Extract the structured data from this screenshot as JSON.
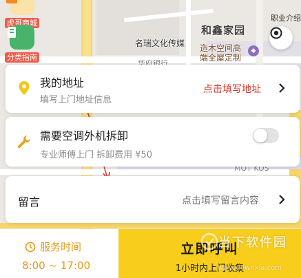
{
  "map": {
    "labels": {
      "tuijian": "虎哥商城",
      "guide": "分类指南",
      "market": "职业介绍",
      "hexin": "和鑫家园",
      "mingrui": "名瑞文化传媒",
      "zaowu_1": "造木空间高",
      "zaowu_2": "端全屋定制",
      "huafu": "华府银行",
      "mot": "MOT KOS"
    }
  },
  "address_card": {
    "title": "我的地址",
    "subtitle": "填写上门地址信息",
    "action": "点击填写地址"
  },
  "ac_card": {
    "title": "需要空调外机拆卸",
    "subtitle": "专业师傅上门 拆卸费用 ¥50",
    "toggle_on": false
  },
  "message_card": {
    "title": "留言",
    "hint": "点击填写留言内容"
  },
  "service_time": {
    "label": "服务时间",
    "range": "8:00 ~ 17:00"
  },
  "call_button": {
    "label": "立即呼叫",
    "subtitle": "1小时内上门收集"
  },
  "watermark": {
    "brand": "当下软件园",
    "url": "www.downxia.com"
  },
  "colors": {
    "accent_yellow": "#f8cd1c",
    "pin_yellow": "#f5c518",
    "time_orange": "#e89a17",
    "action_red": "#d03a2a"
  }
}
